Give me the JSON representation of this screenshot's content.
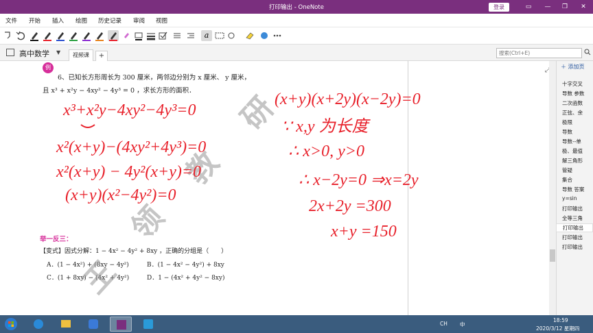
{
  "window": {
    "title": "打印输出 - OneNote",
    "login": "登录"
  },
  "menu": {
    "items": [
      "文件",
      "开始",
      "插入",
      "绘图",
      "历史记录",
      "审阅",
      "视图"
    ]
  },
  "toolbar": {
    "pen_letter": "a"
  },
  "notebook": {
    "name": "高中数学",
    "section_tab": "视频课",
    "add_tab": "+",
    "search_placeholder": "搜索(Ctrl+E)"
  },
  "content": {
    "badge": "例",
    "problem_line1": "6、已知长方形周长为 300 厘米，两邻边分别为 x 厘米、 y 厘米，",
    "problem_line2": "且 x³ + x²y − 4xy² − 4y³ = 0 ，求长方形的面积．",
    "section_title": "举一反三：",
    "variant_stem": "【变式】因式分解：1 − 4x² − 4y² + 8xy ，正确的分组是（　　）",
    "option_a": "A．(1 − 4x²) + (8xy − 4y²)",
    "option_b": "B．(1 − 4x² − 4y²) + 8xy",
    "option_c": "C．(1 + 8xy) − (4x² + 4y²)",
    "option_d": "D．1 − (4x² + 4y² − 8xy)",
    "handwriting_left": [
      "x³+x²y−4xy²−4y³=0",
      "x²(x+y)−(4xy²+4y³)=0",
      "x²(x+y) − 4y²(x+y)=0",
      "(x+y)(x²−4y²)=0"
    ],
    "handwriting_right": [
      "(x+y)(x+2y)(x−2y)=0",
      "∵ x,y 为长度",
      "∴ x>0, y>0",
      "∴ x−2y=0 ⇒x=2y",
      "2x+2y =300",
      "x+y =150"
    ],
    "watermark_chars": [
      "王",
      "领",
      "教",
      "研"
    ]
  },
  "pages": {
    "add_label": "添加页",
    "items": [
      "十字交叉",
      "导数 参数",
      "二次函数",
      "正弦、余",
      "极限",
      "导数",
      "导数--单",
      "极、最值",
      "解三角形",
      "管疑",
      "集合",
      "导数 答案",
      "y=sin",
      "打印输出",
      "全等三角",
      "打印输出",
      "打印输出",
      "打印输出"
    ],
    "selected_index": 15
  },
  "taskbar": {
    "time": "18:59",
    "date": "2020/3/12 星期四",
    "ime": "中",
    "tray_ch": "CH"
  },
  "colors": {
    "titlebar": "#7a2f7e",
    "ink": "#e8202a",
    "accent_pink": "#d62e9a",
    "taskbar": "#3a5c7e"
  }
}
